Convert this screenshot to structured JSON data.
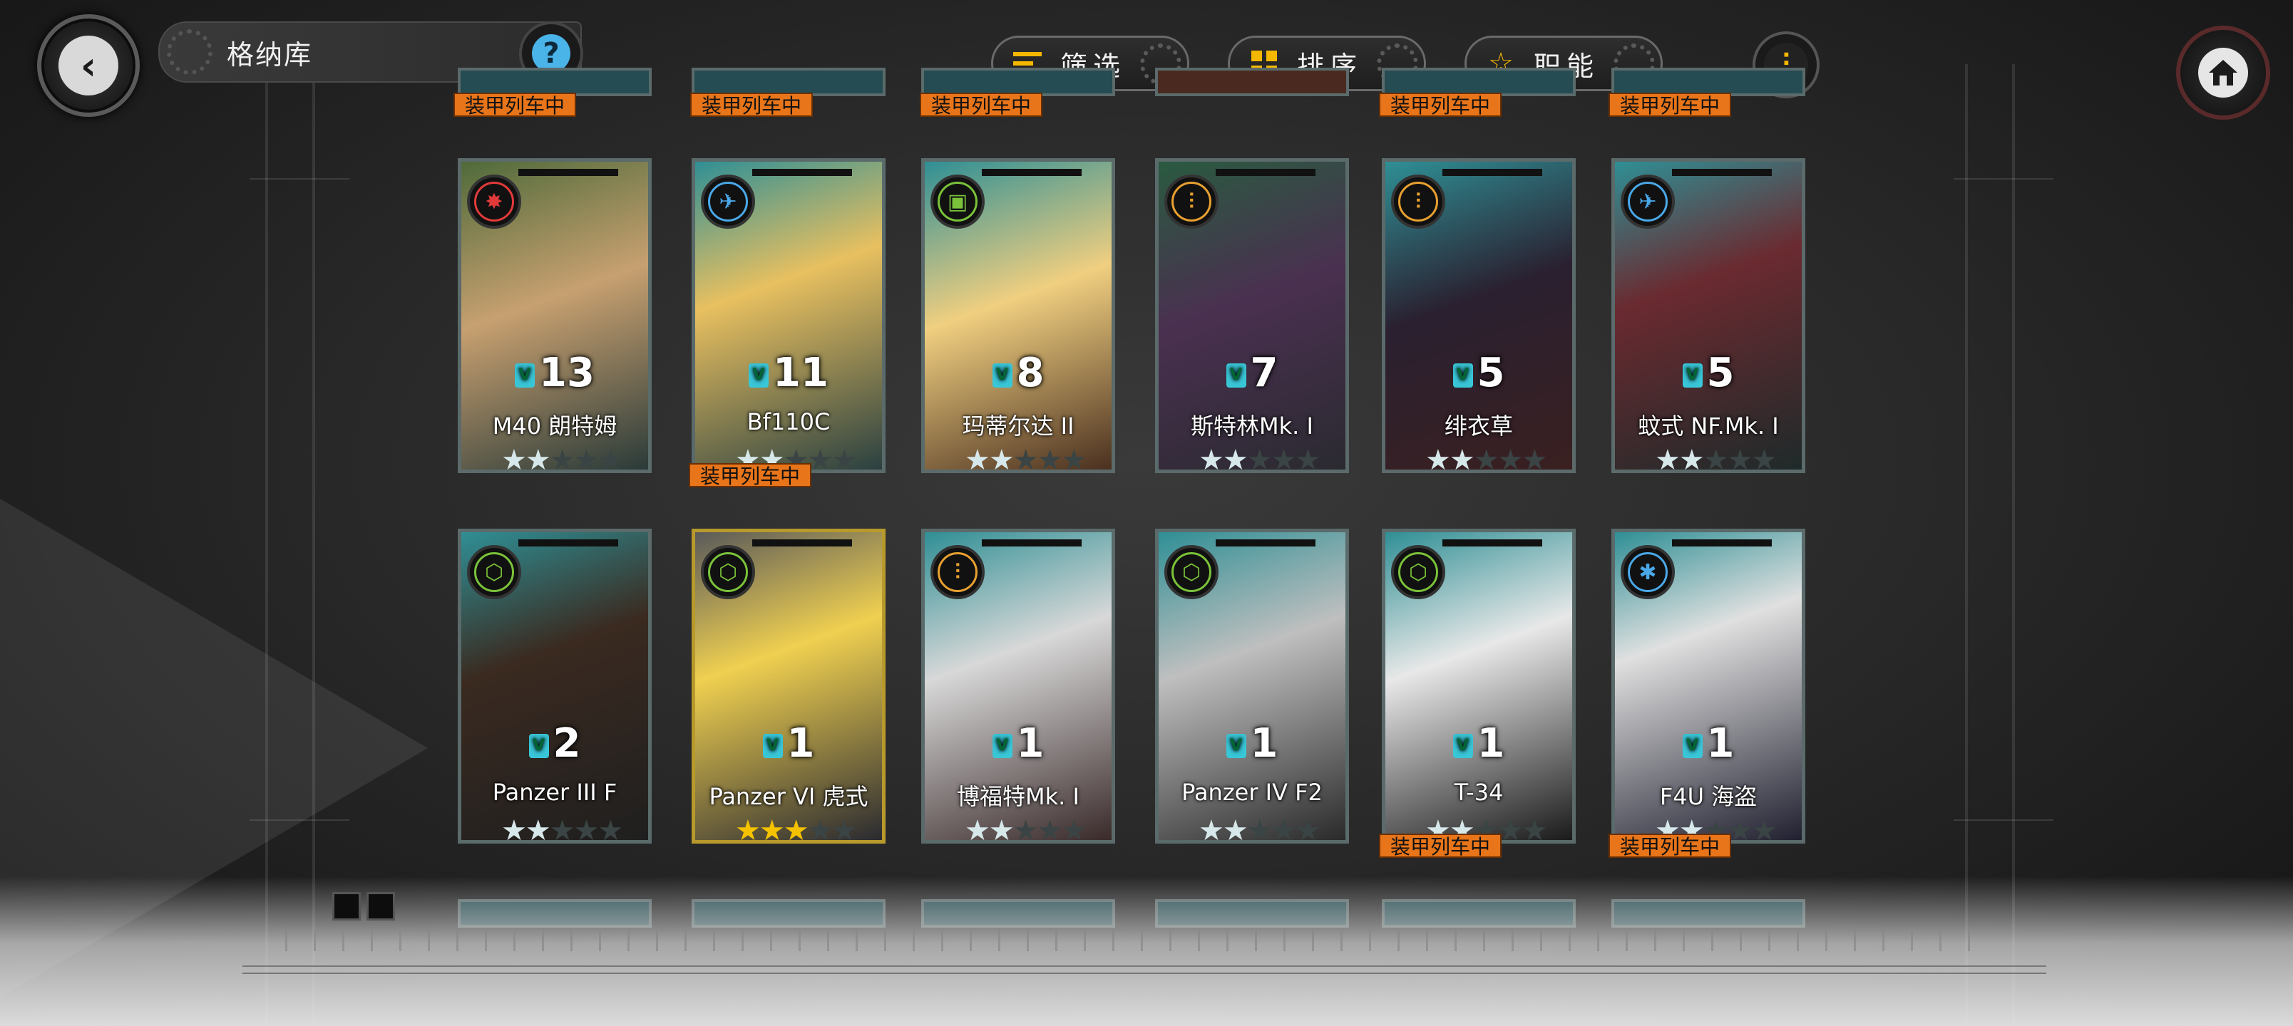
{
  "header": {
    "title": "格纳库",
    "back_icon": "back-arrow-icon",
    "help_label": "?",
    "filter_label": "筛选",
    "sort_label": "排序",
    "role_label": "职能",
    "home_icon": "home-icon"
  },
  "status_badge_text": "装甲列车中",
  "cards": [
    {
      "name": "M40 朗特姆",
      "level": "13",
      "stars": 2,
      "stars_gold": false,
      "role": "red-gear",
      "badge": false
    },
    {
      "name": "Bf110C",
      "level": "11",
      "stars": 2,
      "stars_gold": false,
      "role": "blue-aircraft",
      "badge": true
    },
    {
      "name": "玛蒂尔达 II",
      "level": "8",
      "stars": 2,
      "stars_gold": false,
      "role": "green-shield",
      "badge": false
    },
    {
      "name": "斯特林Mk. I",
      "level": "7",
      "stars": 2,
      "stars_gold": false,
      "role": "orange-artillery",
      "badge": false
    },
    {
      "name": "绯衣草",
      "level": "5",
      "stars": 2,
      "stars_gold": false,
      "role": "orange-artillery",
      "badge": false
    },
    {
      "name": "蚊式 NF.Mk. I",
      "level": "5",
      "stars": 2,
      "stars_gold": false,
      "role": "blue-aircraft",
      "badge": false
    },
    {
      "name": "Panzer III F",
      "level": "2",
      "stars": 2,
      "stars_gold": false,
      "role": "green-tank",
      "badge": false
    },
    {
      "name": "Panzer VI 虎式",
      "level": "1",
      "stars": 3,
      "stars_gold": true,
      "role": "green-tank",
      "badge": false
    },
    {
      "name": "博福特Mk. I",
      "level": "1",
      "stars": 2,
      "stars_gold": false,
      "role": "orange-artillery",
      "badge": false
    },
    {
      "name": "Panzer IV F2",
      "level": "1",
      "stars": 2,
      "stars_gold": false,
      "role": "green-tank",
      "badge": false
    },
    {
      "name": "T-34",
      "level": "1",
      "stars": 2,
      "stars_gold": false,
      "role": "green-tank",
      "badge": true
    },
    {
      "name": "F4U 海盗",
      "level": "1",
      "stars": 2,
      "stars_gold": false,
      "role": "blue-fighter",
      "badge": true
    }
  ],
  "colors": {
    "accent": "#f5b800",
    "badge": "#e8751a",
    "level_badge": "#39c7d8",
    "card_teal": "#2f8f95"
  }
}
